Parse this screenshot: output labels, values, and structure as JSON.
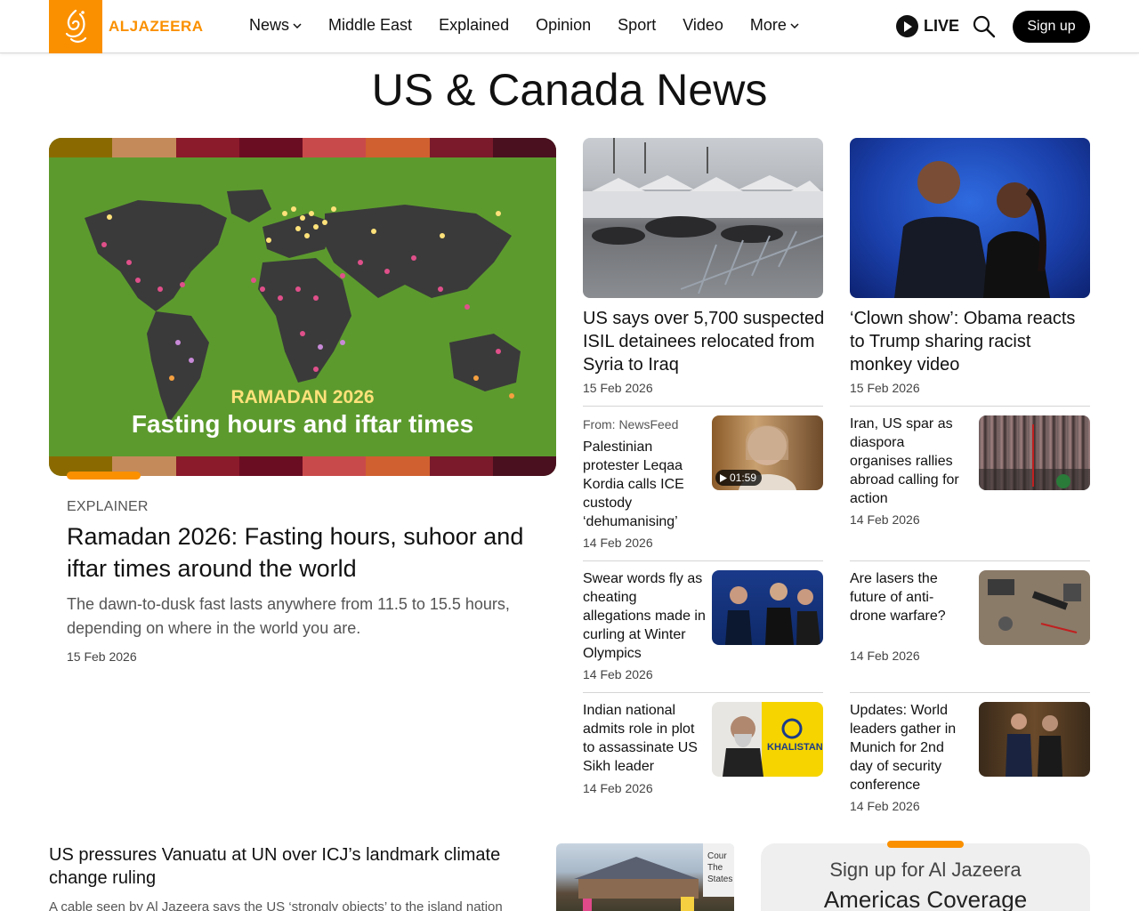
{
  "header": {
    "logo_text": "ALJAZEERA",
    "nav": [
      {
        "label": "News",
        "has_dropdown": true
      },
      {
        "label": "Middle East",
        "has_dropdown": false
      },
      {
        "label": "Explained",
        "has_dropdown": false
      },
      {
        "label": "Opinion",
        "has_dropdown": false
      },
      {
        "label": "Sport",
        "has_dropdown": false
      },
      {
        "label": "Video",
        "has_dropdown": false
      },
      {
        "label": "More",
        "has_dropdown": true
      }
    ],
    "live_label": "LIVE",
    "signup_label": "Sign up"
  },
  "page_title": "US & Canada News",
  "hero": {
    "image_line1": "RAMADAN 2026",
    "image_line2": "Fasting hours and iftar times",
    "kicker": "EXPLAINER",
    "title": "Ramadan 2026: Fasting hours, suhoor and iftar times around the world",
    "description": "The dawn-to-dusk fast lasts anywhere from 11.5 to 15.5 hours, depending on where in the world you are.",
    "date": "15 Feb 2026"
  },
  "featured": [
    {
      "title": "US says over 5,700 suspected ISIL detainees relocated from Syria to Iraq",
      "date": "15 Feb 2026"
    },
    {
      "title": "‘Clown show’: Obama reacts to Trump sharing racist monkey video",
      "date": "15 Feb 2026"
    }
  ],
  "left_list": [
    {
      "source": "From: NewsFeed",
      "title": "Palestinian protester Leqaa Kordia calls ICE custody ‘dehumanising’",
      "date": "14 Feb 2026",
      "video_duration": "01:59"
    },
    {
      "title": "Swear words fly as cheating allegations made in curling at Winter Olympics",
      "date": "14 Feb 2026"
    },
    {
      "title": "Indian national admits role in plot to assassinate US Sikh leader",
      "date": "14 Feb 2026",
      "thumb_text": "KHALISTAN"
    }
  ],
  "right_list": [
    {
      "title": "Iran, US spar as diaspora organises rallies abroad calling for action",
      "date": "14 Feb 2026"
    },
    {
      "title": "Are lasers the future of anti-drone warfare?",
      "date": "14 Feb 2026"
    },
    {
      "title": "Updates: World leaders gather in Munich for 2nd day of security conference",
      "date": "14 Feb 2026"
    }
  ],
  "bottom": {
    "title": "US pressures Vanuatu at UN over ICJ’s landmark climate change ruling",
    "description": "A cable seen by Al Jazeera says the US ‘strongly objects’ to the island nation",
    "image_text": "Cour The States"
  },
  "newsletter": {
    "label": "Sign up for Al Jazeera",
    "title": "Americas Coverage"
  },
  "colors": {
    "brand": "#fa9000",
    "hero_background": "#5c9a2e",
    "map_land": "#3a3a3a"
  }
}
